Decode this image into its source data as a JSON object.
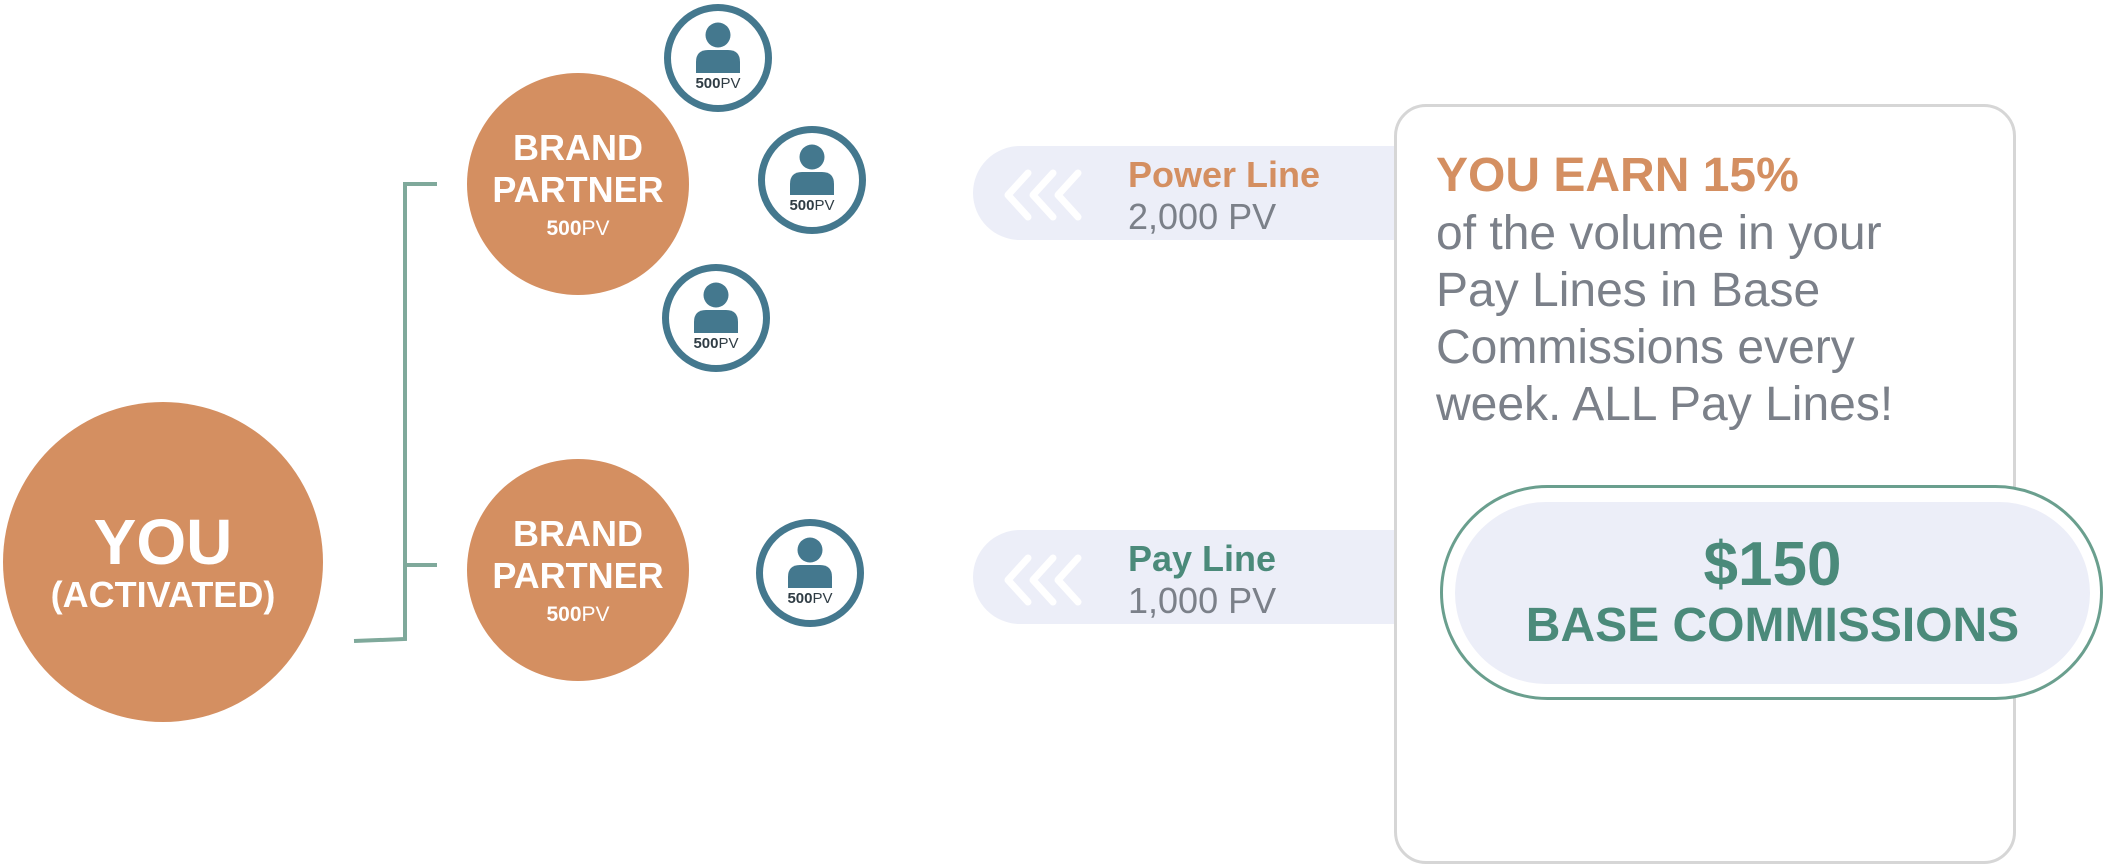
{
  "you": {
    "title": "YOU",
    "subtitle": "(ACTIVATED)"
  },
  "brand_partners": [
    {
      "label": "BRAND PARTNER",
      "pv_value": "500",
      "pv_unit": "PV"
    },
    {
      "label": "BRAND PARTNER",
      "pv_value": "500",
      "pv_unit": "PV"
    }
  ],
  "members": [
    {
      "pv_value": "500",
      "pv_unit": "PV"
    },
    {
      "pv_value": "500",
      "pv_unit": "PV"
    },
    {
      "pv_value": "500",
      "pv_unit": "PV"
    },
    {
      "pv_value": "500",
      "pv_unit": "PV"
    }
  ],
  "lines": [
    {
      "name": "Power Line",
      "volume": "2,000 PV"
    },
    {
      "name": "Pay Line",
      "volume": "1,000 PV"
    }
  ],
  "earnings": {
    "heading": "YOU EARN 15%",
    "body": "of the volume in your Pay Lines in Base Commissions every week. ALL Pay Lines!"
  },
  "commission": {
    "amount": "$150",
    "label": "BASE COMMISSIONS"
  },
  "icons": {
    "member": "person-icon",
    "direction": "chevron-left-icon"
  },
  "colors": {
    "orange": "#d48f61",
    "teal_ring": "#44788e",
    "green_text": "#4b8a7a",
    "connector": "#7fa99b",
    "gray_text": "#7b8089",
    "pill_bg": "#eceef8",
    "card_border": "#d6d6d6"
  }
}
